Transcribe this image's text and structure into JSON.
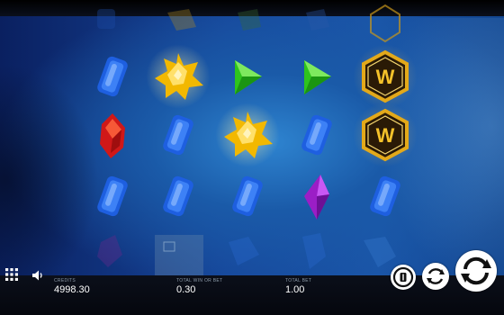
{
  "game": {
    "reels": [
      [
        "blue-gem",
        "red-gem",
        "blue-gem"
      ],
      [
        "yellow-star-gem",
        "blue-gem",
        "blue-gem"
      ],
      [
        "green-gem",
        "yellow-star-gem",
        "blue-gem"
      ],
      [
        "green-gem",
        "blue-gem",
        "purple-gem"
      ],
      [
        "wild",
        "wild",
        "blue-gem"
      ]
    ],
    "wild_label": "W"
  },
  "bottom_bar": {
    "balance": {
      "label": "CREDITS",
      "value": "4998.30"
    },
    "bet_per_line": {
      "label": "TOTAL WIN OR BET",
      "value": "0.30"
    },
    "total_bet": {
      "label": "TOTAL BET",
      "value": "1.00"
    },
    "icons": {
      "menu": "menu-grid-icon",
      "sound": "speaker-icon",
      "autoplay": "autoplay-icon",
      "quick_spin": "quick-spin-icon",
      "spin": "spin-icon"
    }
  },
  "colors": {
    "background": "#1a5aa8",
    "bar": "#05070d",
    "blue_gem": "#1e5fe0",
    "red_gem": "#d01818",
    "yellow_gem": "#f2b800",
    "green_gem": "#2ec41c",
    "purple_gem": "#9b1ec6",
    "wild_gold": "#e3a91a"
  }
}
